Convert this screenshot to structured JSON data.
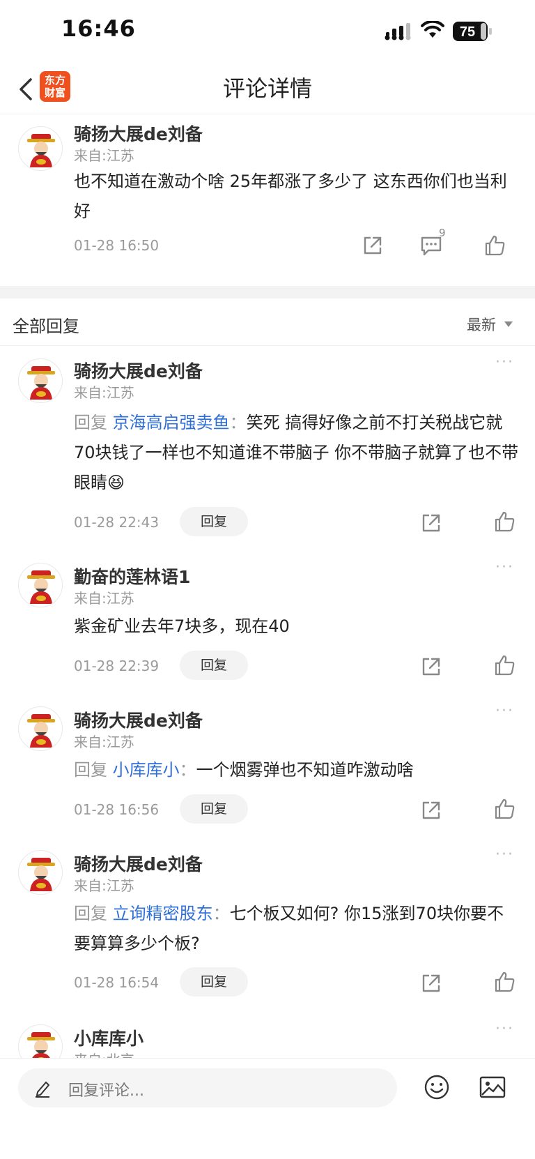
{
  "status_bar": {
    "time": "16:46",
    "battery": "75"
  },
  "nav": {
    "title": "评论详情",
    "logo_line1": "东方",
    "logo_line2": "财富"
  },
  "main_post": {
    "username": "骑扬大展de刘备",
    "location": "来自:江苏",
    "content": "也不知道在激动个啥 25年都涨了多少了 这东西你们也当利好",
    "time": "01-28 16:50",
    "comment_count": "9"
  },
  "replies_section": {
    "label": "全部回复",
    "sort": "最新"
  },
  "replies": [
    {
      "username": "骑扬大展de刘备",
      "location": "来自:江苏",
      "reply_prefix": "回复",
      "mention": "京海高启强卖鱼",
      "separator": "：",
      "content": "笑死 搞得好像之前不打关税战它就70块钱了一样也不知道谁不带脑子 你不带脑子就算了也不带眼睛",
      "emoji": "😆",
      "time": "01-28 22:43",
      "reply_label": "回复"
    },
    {
      "username": "勤奋的莲林语1",
      "location": "来自:江苏",
      "content": "紫金矿业去年7块多，现在40",
      "time": "01-28 22:39",
      "reply_label": "回复"
    },
    {
      "username": "骑扬大展de刘备",
      "location": "来自:江苏",
      "reply_prefix": "回复",
      "mention": "小库库小",
      "separator": "：",
      "content": "一个烟雾弹也不知道咋激动啥",
      "time": "01-28 16:56",
      "reply_label": "回复"
    },
    {
      "username": "骑扬大展de刘备",
      "location": "来自:江苏",
      "reply_prefix": "回复",
      "mention": "立询精密股东",
      "separator": "：",
      "content": "七个板又如何? 你15涨到70块你要不要算算多少个板?",
      "time": "01-28 16:54",
      "reply_label": "回复"
    },
    {
      "username": "小库库小",
      "location": "来自:北京"
    }
  ],
  "more_label": "···",
  "bottom_bar": {
    "placeholder": "回复评论..."
  },
  "colors": {
    "brand": "#f0501e",
    "mention": "#2f6fd6",
    "muted": "#999999"
  }
}
